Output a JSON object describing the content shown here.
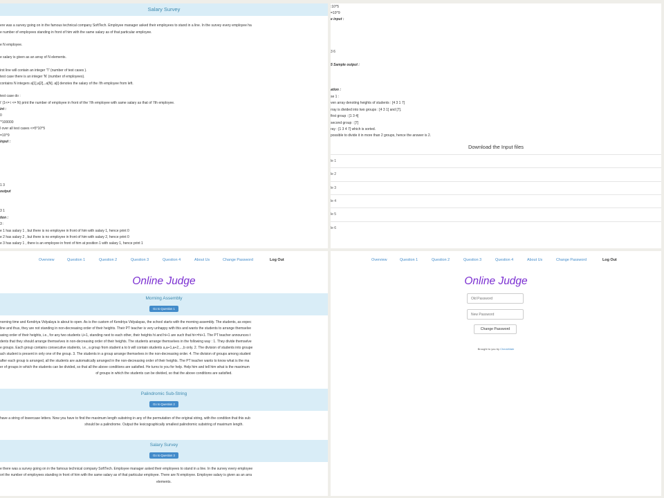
{
  "panel1": {
    "header": "Salary Survey",
    "lines": [
      "ere was a survey going on in the famous technical company SoftTech. Employee manager asked their employees to stand in a line. In the survey every employee ha",
      "e number of employees standing in front of him with the same salary as of that particular employee.",
      "e N employee.",
      "e salary is given as an array of N elements.",
      "irst line will contain an integer 'T' (number of test cases ).",
      "test case there is an integer 'N' (number of employees).",
      "contains N integers a[1],a[2],..a[N]. a[i] denotes the salary of the i'th employee from left.",
      "test case do :",
      "i' (1<= i <= N) print the number of employee in front of the 'i'th employee with same salary as that of 'i'th employee.",
      "int :",
      "0",
      "'*100000",
      "l over all test cases <=5*10^5",
      "=10^9",
      "input :",
      "",
      "",
      "",
      "1 3",
      "output",
      "3 1",
      "tion :",
      "3 :",
      "e 1 has salary 1 , but there is no employee in front of him with salary 1, hence print 0",
      "e 2 has salary 2 , but there is no employee in front of him with salary 2, hence print 0",
      "e 3 has salary 1 , there is an employee in front of him at position 1 with salary 1, hence print 1",
      "4 has salary 1 , there are two employees in front of him at position 1 and 3 with salary 1, hence"
    ]
  },
  "panel2": {
    "lines": [
      ":10^5",
      "=10^9",
      "e input :",
      "3 6",
      "5 Sample output :",
      "ation :",
      "se 1 :",
      "ven array denoting heights of students : [4 3 1 7]",
      "rray is divided into two groups : [4 3 1] and [7].",
      "first group : [1 3 4]",
      "second group : [7]",
      "ray : [1 3 4 7] which is sorted.",
      "possible to divide it in more than 2 groups, hence the answer is 2."
    ],
    "download_title": "Download the Input files",
    "files": [
      "le 1",
      "le 2",
      "le 3",
      "le 4",
      "le 5",
      "le 6"
    ]
  },
  "nav": {
    "items": [
      "Overview",
      "Question 1",
      "Question 2",
      "Question 3",
      "Question 4",
      "About Us",
      "Change Password"
    ],
    "logout": "Log Out"
  },
  "site_title": "Online Judge",
  "questions": [
    {
      "title": "Morning Assembly",
      "button": "Go to Question 1",
      "desc": [
        "norning time and Kendriya Vidyalaya is about to open. As is the custom of Kendriya Vidyalayas, the school starts with the morning assembly. The students, as expec",
        "line and thus, they are not standing in non-decreasing order of their heights. Their PT teacher is very unhappy with this and wants the students to arrange themselve",
        "asing order of their heights, i.e., for any two students i,i+1, standing next to each other, their heights hi and hi+1 are such that hi<=hi+1. The PT teacher announces t",
        "dents that they should arrange themselves in non-decreasing order of their heights. The students arrange themselves in the following way : 1. They divide themselve",
        "e groups. Each group contains consecutive students, i.e., a group from student a to b will contain students a,a+1,a+2,...,b only. 2. The division of students into groupe",
        "ach student is present in only one of the group. 3. The students in a group arrange themselves in the non-decreasing order. 4. The division of groups among student",
        "after each group is arranged, all the students are automatically arranged in the non-decreasing order of their heights. The PT teacher wants to know what is the ma",
        "er of groups in which the students can be divided, so that all the above conditions are satisfied. He turns to you for help. Help him and tell him what is the maximum",
        "of groups in which the students can be divided, so that the above conditions are satisfied."
      ]
    },
    {
      "title": "Palindromic Sub-String",
      "button": "Go to Question 2",
      "desc": [
        "have a string of lowercase letters. Now you have to find the maximum length substring in any of the permutation of the original string, with the condition that this sub",
        "should be a palindrome. Output the lexicographically smallest palindromic substring of maximum length."
      ]
    },
    {
      "title": "Salary Survey",
      "button": "Go to Question 3",
      "desc": [
        "e there was a survey going on in the famous technical company SoftTech. Employee manager asked their employees to stand in a line. In the survey every employee",
        "ort the number of employees standing in front of him with the same salary as of that particular employee. There are N employee. Employee salary is given as an arra",
        "elements."
      ]
    }
  ],
  "change_password": {
    "old_placeholder": "Old Password",
    "new_placeholder": "New Password",
    "button": "Change Password",
    "brought_prefix": "Brought to you by ",
    "brought_link": "CheckMate"
  },
  "colors": {
    "link": "#428bca",
    "title_purple": "#7b2fd1",
    "panel_heading_bg": "#d9edf7",
    "panel_heading_text": "#3a87ad"
  }
}
